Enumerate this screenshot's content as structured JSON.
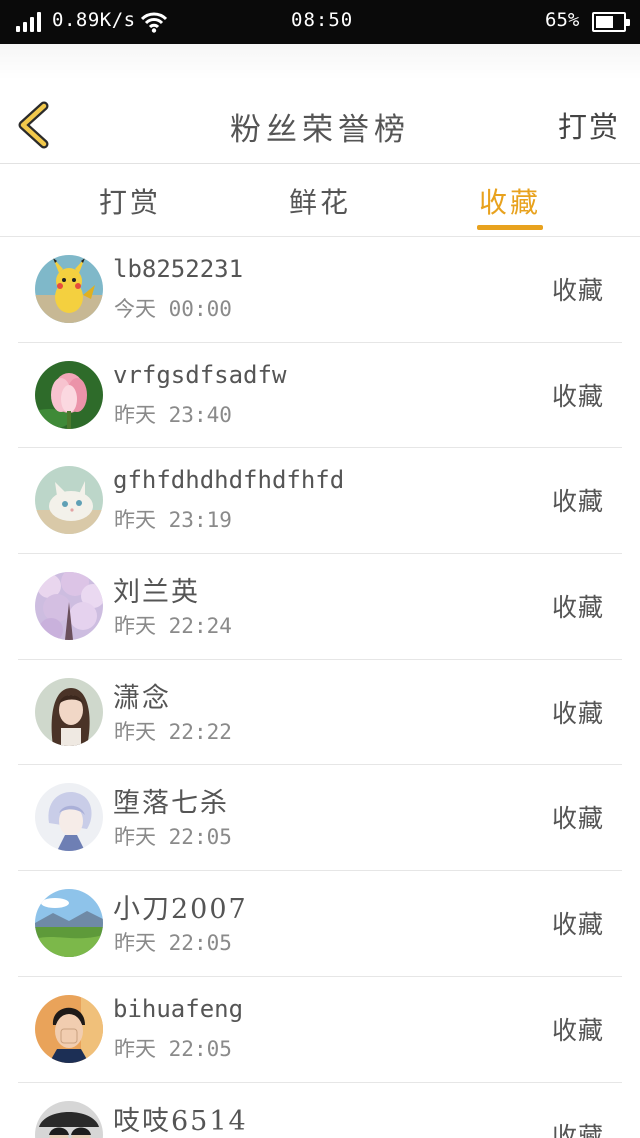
{
  "status_bar": {
    "net_speed": "0.89K/s",
    "time": "08:50",
    "battery": "65%",
    "battery_level": 0.65
  },
  "header": {
    "title": "粉丝荣誉榜",
    "right_link": "打赏",
    "back_icon": "chevron-left-icon",
    "accent_color": "#e8a21e"
  },
  "tabs": [
    {
      "label": "打赏",
      "active": false
    },
    {
      "label": "鲜花",
      "active": false
    },
    {
      "label": "收藏",
      "active": true
    }
  ],
  "fans": [
    {
      "name": "lb8252231",
      "day": "今天",
      "time": "00:00",
      "action": "收藏",
      "avatar": "pikachu"
    },
    {
      "name": "vrfgsdfsadfw",
      "day": "昨天",
      "time": "23:40",
      "action": "收藏",
      "avatar": "lotus"
    },
    {
      "name": "gfhfdhdhdfhdfhfd",
      "day": "昨天",
      "time": "23:19",
      "action": "收藏",
      "avatar": "kitten"
    },
    {
      "name": "刘兰英",
      "day": "昨天",
      "time": "22:24",
      "action": "收藏",
      "avatar": "cherry-blossom"
    },
    {
      "name": "潇念",
      "day": "昨天",
      "time": "22:22",
      "action": "收藏",
      "avatar": "girl-portrait"
    },
    {
      "name": "堕落七杀",
      "day": "昨天",
      "time": "22:05",
      "action": "收藏",
      "avatar": "anime-boy"
    },
    {
      "name": "小刀2007",
      "day": "昨天",
      "time": "22:05",
      "action": "收藏",
      "avatar": "landscape"
    },
    {
      "name": "bihuafeng",
      "day": "昨天",
      "time": "22:05",
      "action": "收藏",
      "avatar": "boy-portrait"
    },
    {
      "name": "吱吱6514",
      "day": "",
      "time": "",
      "action": "收藏",
      "avatar": "couple-photo"
    }
  ]
}
